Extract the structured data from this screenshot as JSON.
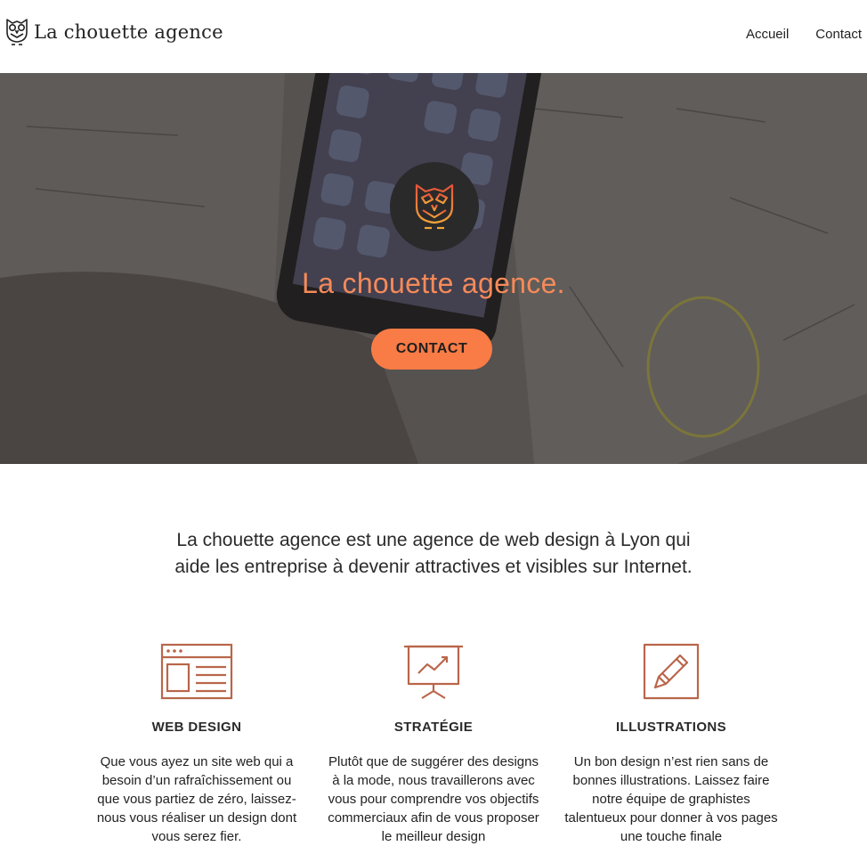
{
  "header": {
    "brand_name": "La chouette agence",
    "nav": [
      "Accueil",
      "Contact"
    ]
  },
  "hero": {
    "title": "La chouette agence.",
    "cta_label": "CONTACT"
  },
  "intro": {
    "text": "La chouette agence est une agence de web design à Lyon qui aide les entreprise à devenir attractives et visibles sur Internet."
  },
  "services": [
    {
      "icon": "browser-window-icon",
      "title": "WEB DESIGN",
      "text": "Que vous ayez un site web qui a besoin d’un rafraîchissement ou que vous partiez de zéro, laissez-nous vous réaliser un design dont vous serez fier."
    },
    {
      "icon": "presentation-chart-icon",
      "title": "STRATÉGIE",
      "text": "Plutôt que de suggérer des designs à la mode, nous travaillerons avec vous pour comprendre vos objectifs commerciaux afin de vous proposer le meilleur design"
    },
    {
      "icon": "pencil-edit-icon",
      "title": "ILLUSTRATIONS",
      "text": "Un bon design n’est rien sans de bonnes illustrations. Laissez faire notre équipe de graphistes talentueux pour donner à vos pages une touche finale"
    }
  ],
  "colors": {
    "accent": "#f97b45",
    "hero_title": "#f58a5a",
    "icon_stroke": "#b9664a",
    "hero_logo_bg": "#2b2a2a"
  }
}
